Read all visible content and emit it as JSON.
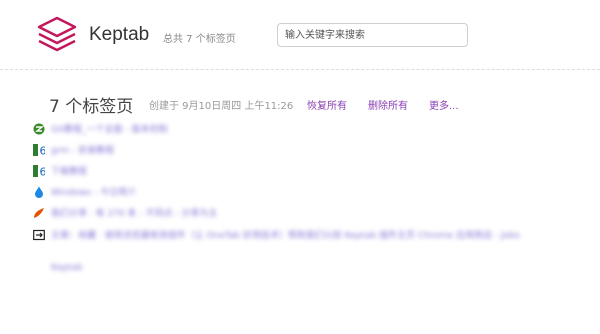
{
  "app": {
    "name": "Keptab",
    "total_text": "总共 7 个标签页"
  },
  "search": {
    "placeholder": "输入关键字来搜索",
    "value": ""
  },
  "group": {
    "title": "7 个标签页",
    "created": "创建于 9月10日周四 上午11:26",
    "actions": {
      "restore_all": "恢复所有",
      "delete_all": "删除所有",
      "more": "更多..."
    }
  },
  "tabs": [
    {
      "title": "Git教程_一个全面 - 版本控制",
      "icon": "green-circle-icon"
    },
    {
      "title": "grm - 安装教程",
      "icon": "num-6-icon"
    },
    {
      "title": "下载教程",
      "icon": "num-6-icon"
    },
    {
      "title": "Windows - 今日简介",
      "icon": "water-drop-icon"
    },
    {
      "title": "我们分享 · 有 270 条 - 不同点 - 分享为主",
      "icon": "orange-bird-icon"
    },
    {
      "title": "文章：收藏 · 使用浏览器有效组件（让 OneTab 好用技术）帮助我们以前 Keptab 插件主页 Chrome 应用商店 - Jobs",
      "icon": "exit-icon"
    },
    {
      "title": "Keptab",
      "icon": ""
    }
  ],
  "colors": {
    "accent": "#8a3fb5",
    "logo": "#c2185b",
    "link": "#6a5acd"
  }
}
